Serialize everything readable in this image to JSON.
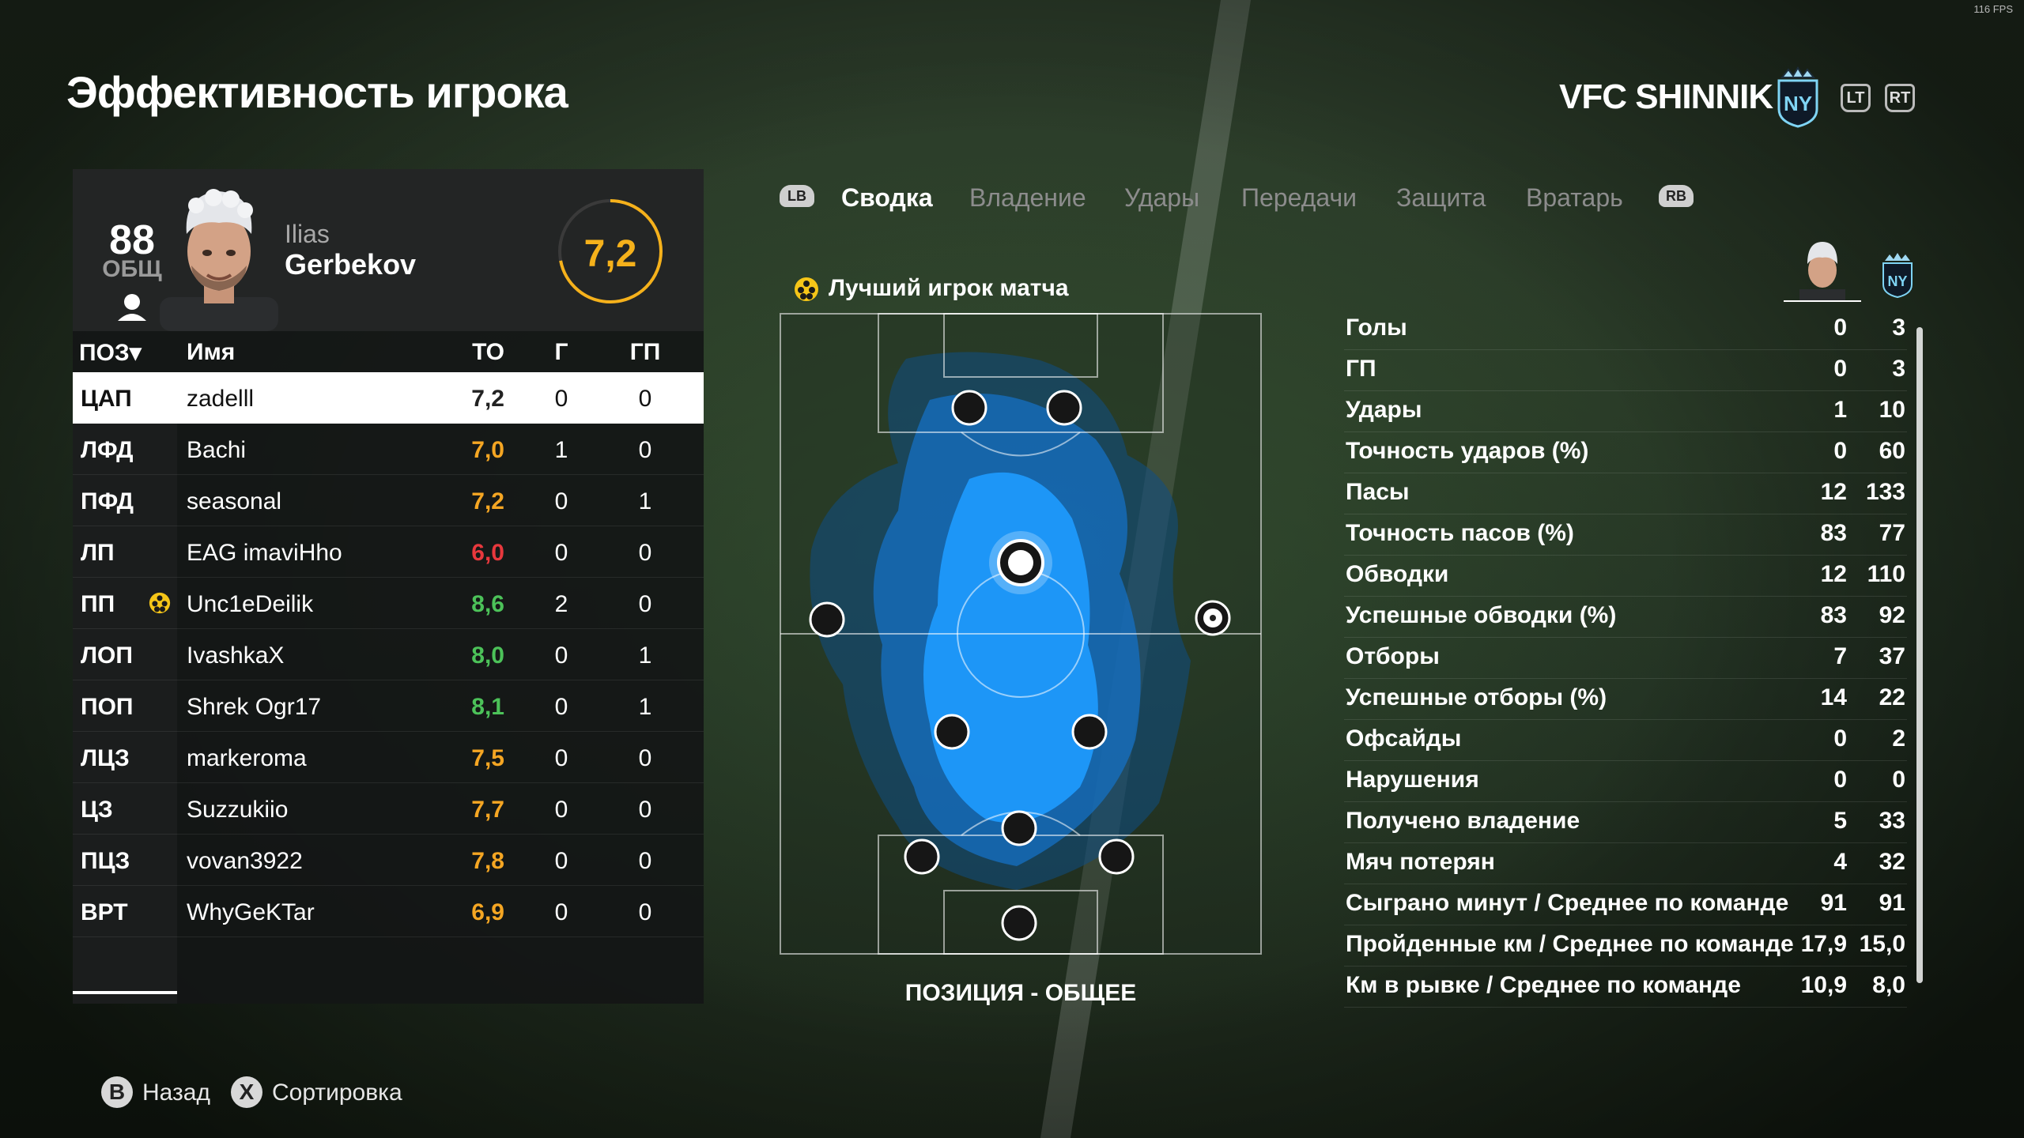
{
  "hud": {
    "fps": "116 FPS"
  },
  "page_title": "Эффективность игрока",
  "club": {
    "name": "VFC SHINNIK",
    "crest_text": "NY",
    "lt": "LT",
    "rt": "RT"
  },
  "player": {
    "overall": "88",
    "overall_label": "ОБЩ",
    "first_name": "Ilias",
    "last_name": "Gerbekov",
    "rating": "7,2",
    "rating_fraction": 0.72
  },
  "table": {
    "headers": {
      "pos": "ПОЗ▾",
      "name": "Имя",
      "rating": "ТО",
      "goals": "Г",
      "assists": "ГП"
    },
    "rows": [
      {
        "pos": "ЦАП",
        "name": "zadelll",
        "rating": "7,2",
        "goals": "0",
        "assists": "0",
        "color": "#222222",
        "selected": true,
        "motm": false
      },
      {
        "pos": "ЛФД",
        "name": "Bachi",
        "rating": "7,0",
        "goals": "1",
        "assists": "0",
        "color": "#f5a623",
        "selected": false,
        "motm": false
      },
      {
        "pos": "ПФД",
        "name": "seasonal",
        "rating": "7,2",
        "goals": "0",
        "assists": "1",
        "color": "#f5a623",
        "selected": false,
        "motm": false
      },
      {
        "pos": "ЛП",
        "name": "EAG imaviHho",
        "rating": "6,0",
        "goals": "0",
        "assists": "0",
        "color": "#e8383d",
        "selected": false,
        "motm": false
      },
      {
        "pos": "ПП",
        "name": "Unc1eDeilik",
        "rating": "8,6",
        "goals": "2",
        "assists": "0",
        "color": "#4cc259",
        "selected": false,
        "motm": true
      },
      {
        "pos": "ЛОП",
        "name": "IvashkaX",
        "rating": "8,0",
        "goals": "0",
        "assists": "1",
        "color": "#4cc259",
        "selected": false,
        "motm": false
      },
      {
        "pos": "ПОП",
        "name": "Shrek Ogr17",
        "rating": "8,1",
        "goals": "0",
        "assists": "1",
        "color": "#4cc259",
        "selected": false,
        "motm": false
      },
      {
        "pos": "ЛЦЗ",
        "name": "markeroma",
        "rating": "7,5",
        "goals": "0",
        "assists": "0",
        "color": "#f5a623",
        "selected": false,
        "motm": false
      },
      {
        "pos": "ЦЗ",
        "name": "Suzzukiio",
        "rating": "7,7",
        "goals": "0",
        "assists": "0",
        "color": "#f5a623",
        "selected": false,
        "motm": false
      },
      {
        "pos": "ПЦЗ",
        "name": "vovan3922",
        "rating": "7,8",
        "goals": "0",
        "assists": "0",
        "color": "#f5a623",
        "selected": false,
        "motm": false
      },
      {
        "pos": "ВРТ",
        "name": "WhyGeKTar",
        "rating": "6,9",
        "goals": "0",
        "assists": "0",
        "color": "#f5a623",
        "selected": false,
        "motm": false
      }
    ]
  },
  "tabs": {
    "lb": "LB",
    "rb": "RB",
    "items": [
      "Сводка",
      "Владение",
      "Удары",
      "Передачи",
      "Защита",
      "Вратарь"
    ],
    "active": 0
  },
  "motm_label": "Лучший игрок матча",
  "heatmap_caption": "ПОЗИЦИЯ - ОБЩЕЕ",
  "stats": [
    {
      "label": "Голы",
      "player": "0",
      "team": "3"
    },
    {
      "label": "ГП",
      "player": "0",
      "team": "3"
    },
    {
      "label": "Удары",
      "player": "1",
      "team": "10"
    },
    {
      "label": "Точность ударов (%)",
      "player": "0",
      "team": "60"
    },
    {
      "label": "Пасы",
      "player": "12",
      "team": "133"
    },
    {
      "label": "Точность пасов (%)",
      "player": "83",
      "team": "77"
    },
    {
      "label": "Обводки",
      "player": "12",
      "team": "110"
    },
    {
      "label": "Успешные обводки (%)",
      "player": "83",
      "team": "92"
    },
    {
      "label": "Отборы",
      "player": "7",
      "team": "37"
    },
    {
      "label": "Успешные отборы (%)",
      "player": "14",
      "team": "22"
    },
    {
      "label": "Офсайды",
      "player": "0",
      "team": "2"
    },
    {
      "label": "Нарушения",
      "player": "0",
      "team": "0"
    },
    {
      "label": "Получено владение",
      "player": "5",
      "team": "33"
    },
    {
      "label": "Мяч потерян",
      "player": "4",
      "team": "32"
    },
    {
      "label": "Сыграно минут / Среднее по команде",
      "player": "91",
      "team": "91"
    },
    {
      "label": "Пройденные км / Среднее по команде",
      "player": "17,9",
      "team": "15,0"
    },
    {
      "label": "Км в рывке / Среднее по команде",
      "player": "10,9",
      "team": "8,0"
    }
  ],
  "footer": {
    "back": {
      "key": "B",
      "label": "Назад"
    },
    "sort": {
      "key": "X",
      "label": "Сортировка"
    }
  },
  "colors": {
    "rating_ring": "#f5b11b",
    "heat": "#1e9bff"
  }
}
